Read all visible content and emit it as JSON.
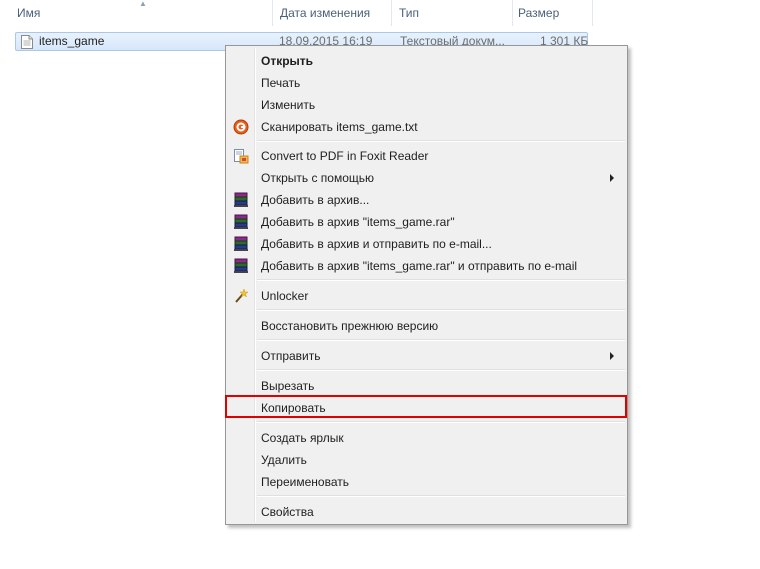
{
  "columns": {
    "name": "Имя",
    "date": "Дата изменения",
    "type": "Тип",
    "size": "Размер"
  },
  "file": {
    "name": "items_game",
    "date": "18.09.2015 16:19",
    "type": "Текстовый докум...",
    "size": "1 301 КБ",
    "icon": "text-file-icon"
  },
  "menu": {
    "open": "Открыть",
    "print": "Печать",
    "edit": "Изменить",
    "scan": "Сканировать items_game.txt",
    "convert_pdf": "Convert to PDF in Foxit Reader",
    "open_with": "Открыть с помощью",
    "add_archive": "Добавить в архив...",
    "add_rar": "Добавить в архив \"items_game.rar\"",
    "add_archive_email": "Добавить в архив и отправить по e-mail...",
    "add_rar_email": "Добавить в архив \"items_game.rar\" и отправить по e-mail",
    "unlocker": "Unlocker",
    "restore": "Восстановить прежнюю версию",
    "send_to": "Отправить",
    "cut": "Вырезать",
    "copy": "Копировать",
    "create_shortcut": "Создать ярлык",
    "delete": "Удалить",
    "rename": "Переименовать",
    "properties": "Свойства"
  },
  "colors": {
    "highlight_border": "#e00000",
    "menu_background": "#f0f0f0"
  }
}
